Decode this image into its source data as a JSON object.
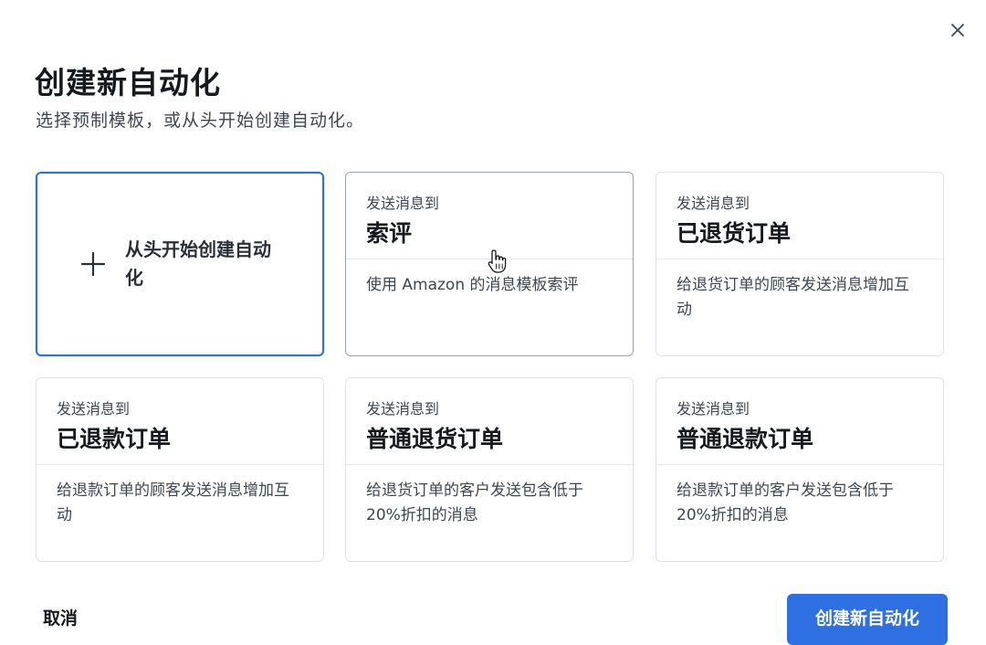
{
  "dialog": {
    "title": "创建新自动化",
    "subtitle": "选择预制模板，或从头开始创建自动化。",
    "close_icon": "close-icon"
  },
  "scratch_card": {
    "label": "从头开始创建自动化",
    "icon": "plus-icon"
  },
  "templates": [
    {
      "kicker": "发送消息到",
      "title": "索评",
      "description": "使用 Amazon 的消息模板索评"
    },
    {
      "kicker": "发送消息到",
      "title": "已退货订单",
      "description": "给退货订单的顾客发送消息增加互动"
    },
    {
      "kicker": "发送消息到",
      "title": "已退款订单",
      "description": "给退款订单的顾客发送消息增加互动"
    },
    {
      "kicker": "发送消息到",
      "title": "普通退货订单",
      "description": "给退货订单的客户发送包含低于20%折扣的消息"
    },
    {
      "kicker": "发送消息到",
      "title": "普通退款订单",
      "description": "给退款订单的客户发送包含低于20%折扣的消息"
    }
  ],
  "footer": {
    "cancel_label": "取消",
    "create_label": "创建新自动化"
  },
  "colors": {
    "accent": "#2f6fe4",
    "card_border": "#dfe3e8",
    "text_primary": "#16191d",
    "text_secondary": "#3e4650"
  }
}
